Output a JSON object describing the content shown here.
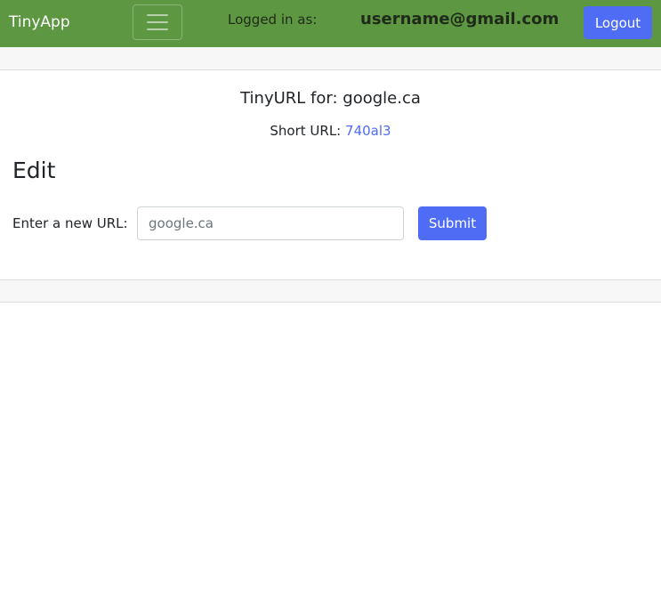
{
  "navbar": {
    "brand": "TinyApp",
    "toggler_icon": "hamburger-menu-icon",
    "logged_in_label": "Logged in as:",
    "username": "username@gmail.com",
    "logout_label": "Logout",
    "background_color": "#5d9741"
  },
  "card": {
    "title": "TinyURL for: google.ca",
    "short_url_label": "Short URL:",
    "short_url_value": "740al3"
  },
  "edit_form": {
    "heading": "Edit",
    "url_label": "Enter a new URL:",
    "url_placeholder": "google.ca",
    "submit_label": "Submit"
  },
  "colors": {
    "accent": "#4f6cf5",
    "link": "#4f6cf5"
  }
}
